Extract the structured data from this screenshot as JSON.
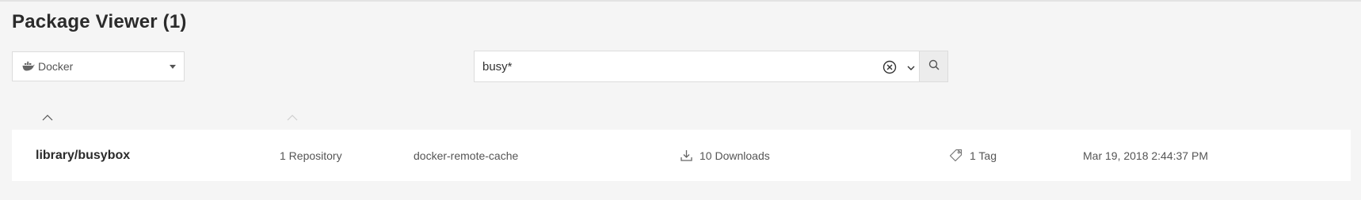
{
  "page": {
    "title": "Package Viewer (1)"
  },
  "filter": {
    "package_type": "Docker",
    "icons": {
      "type_icon": "docker-whale-icon",
      "dropdown_icon": "caret-down-icon"
    }
  },
  "search": {
    "value": "busy*",
    "icons": {
      "clear": "clear-circle-x-icon",
      "options": "chevron-down-icon",
      "submit": "search-icon"
    }
  },
  "table": {
    "sort_icons": [
      "chevron-up-icon",
      "chevron-up-icon"
    ],
    "rows": [
      {
        "name": "library/busybox",
        "repositories": "1 Repository",
        "repository_name": "docker-remote-cache",
        "downloads": "10 Downloads",
        "tags": "1 Tag",
        "last_modified": "Mar 19, 2018 2:44:37 PM"
      }
    ]
  },
  "colors": {
    "background": "#f5f5f5",
    "row_background": "#ffffff",
    "title_text": "#2b2b2b",
    "muted_text": "#555555"
  }
}
